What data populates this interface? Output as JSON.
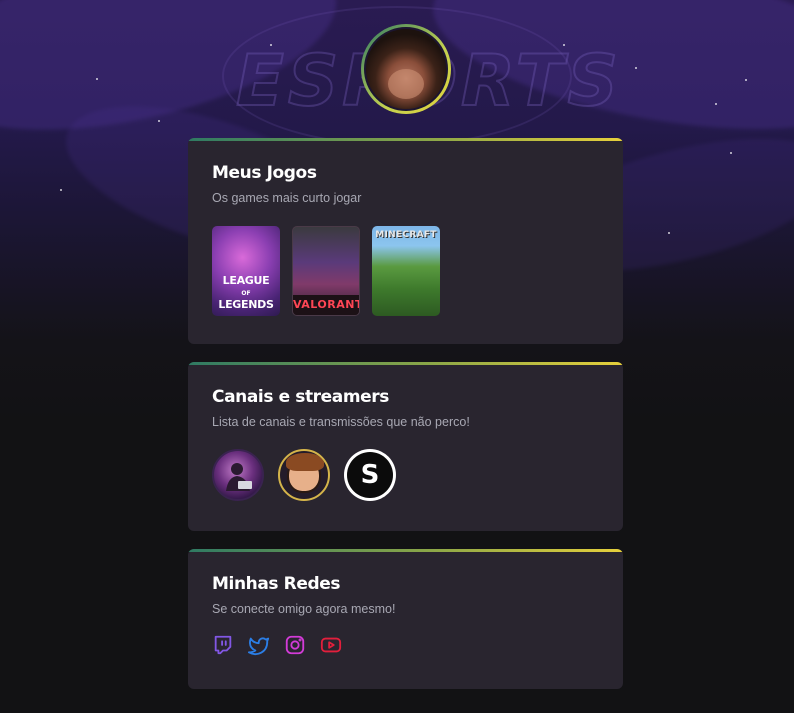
{
  "profile": {
    "avatar_icon": "profile-photo"
  },
  "games_card": {
    "title": "Meus Jogos",
    "subtitle": "Os games mais curto jogar",
    "games": [
      {
        "label": "LEAGUE OF LEGENDS",
        "line1": "LEAGUE",
        "line2": "LEGENDS"
      },
      {
        "label": "VALORANT"
      },
      {
        "label": "MINECRAFT"
      }
    ]
  },
  "channels_card": {
    "title": "Canais e streamers",
    "subtitle": "Lista de canais e transmissões que não perco!",
    "channels": [
      {
        "icon": "streamer-avatar-1"
      },
      {
        "icon": "streamer-avatar-2"
      },
      {
        "icon": "streamer-avatar-3",
        "glyph": "S"
      }
    ]
  },
  "social_card": {
    "title": "Minhas Redes",
    "subtitle": "Se conecte omigo agora mesmo!",
    "links": [
      {
        "icon": "twitch-icon",
        "color": "#8257e5"
      },
      {
        "icon": "twitter-icon",
        "color": "#2b7ee6"
      },
      {
        "icon": "instagram-icon",
        "color": "#d33bd8"
      },
      {
        "icon": "youtube-icon",
        "color": "#e21f3c"
      }
    ]
  },
  "colors": {
    "background": "#121214",
    "card": "#29252f",
    "accent_gradient_start": "#2f7a63",
    "accent_gradient_end": "#e6d03c",
    "title": "#ffffff",
    "subtitle": "#a8a8b3"
  }
}
